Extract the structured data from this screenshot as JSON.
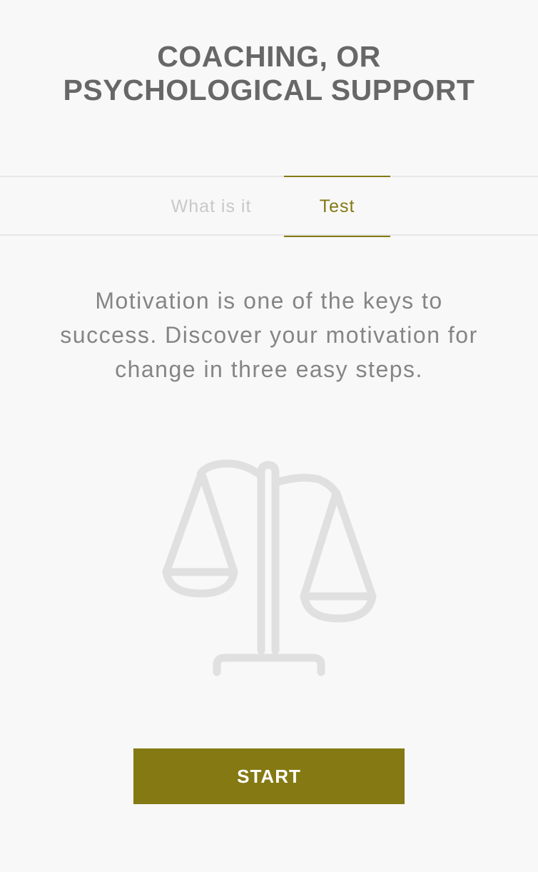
{
  "header": {
    "title_line1": "COACHING, OR",
    "title_line2": "PSYCHOLOGICAL SUPPORT"
  },
  "tabs": [
    {
      "label": "What is it",
      "active": false
    },
    {
      "label": "Test",
      "active": true
    }
  ],
  "main": {
    "description": "Motivation is one of the keys to success. Discover your motivation for change in three easy steps.",
    "illustration_icon": "balance-scale-icon",
    "start_label": "START"
  },
  "colors": {
    "accent": "#857913",
    "background": "#f8f8f8",
    "title_text": "#676767",
    "body_text": "#858585",
    "inactive_tab": "#c9c9c9",
    "divider": "#e6e6e6",
    "icon_stroke": "#e0e0e0"
  }
}
